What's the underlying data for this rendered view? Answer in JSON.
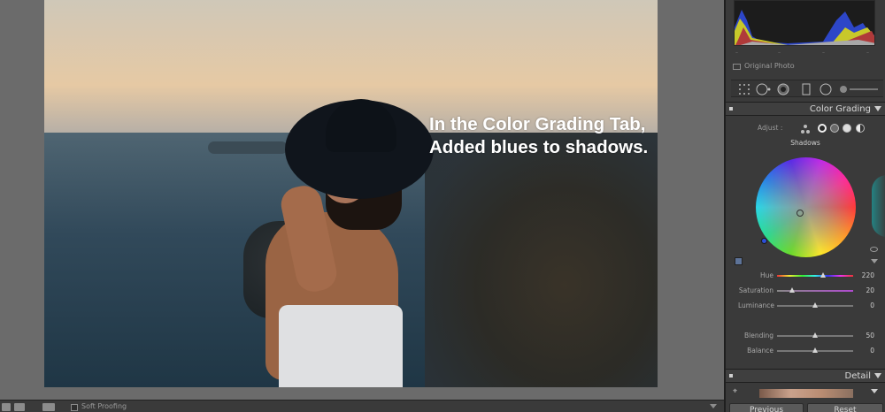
{
  "annotation": {
    "line1": "In the Color Grading Tab,",
    "line2": "Added blues to shadows."
  },
  "toolbar": {
    "soft_proofing_label": "Soft Proofing"
  },
  "histogram": {
    "original_photo_label": "Original Photo",
    "ticks": [
      "–",
      "–",
      "–",
      "–"
    ]
  },
  "color_grading": {
    "title": "Color Grading",
    "adjust_label": "Adjust :",
    "selected_mode": "Shadows",
    "selected_label": "Shadows",
    "sliders": [
      {
        "name": "Hue",
        "value": "220",
        "fraction": 0.61
      },
      {
        "name": "Saturation",
        "value": "20",
        "fraction": 0.2
      },
      {
        "name": "Luminance",
        "value": "0",
        "fraction": 0.5
      },
      {
        "name": "Blending",
        "value": "50",
        "fraction": 0.5
      },
      {
        "name": "Balance",
        "value": "0",
        "fraction": 0.5
      }
    ],
    "colors": {
      "shadow_tint": "#5d7398",
      "wheel_pointer": "#2c4fd8"
    }
  },
  "detail": {
    "title": "Detail"
  },
  "buttons": {
    "previous": "Previous",
    "reset": "Reset"
  }
}
